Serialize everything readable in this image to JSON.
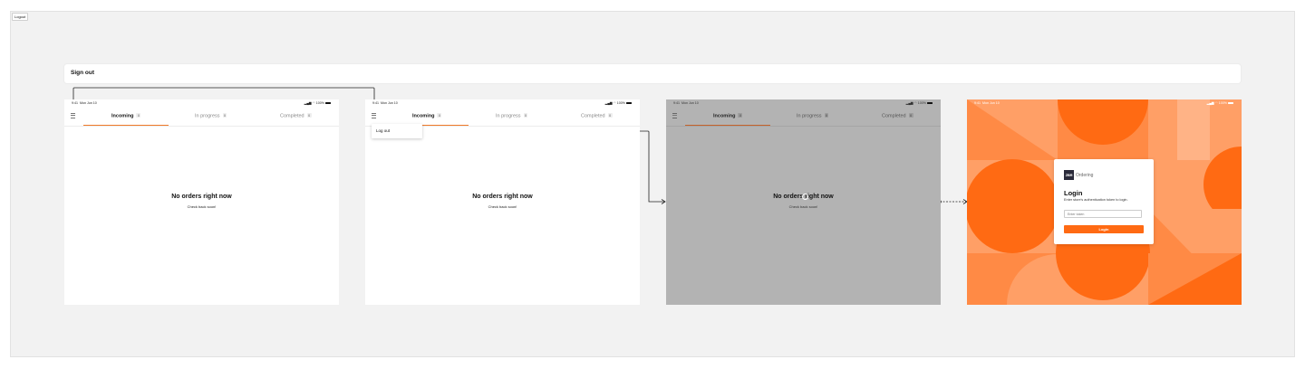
{
  "page": {
    "frame_tag": "Logout",
    "section_title": "Sign out"
  },
  "status": {
    "time": "9:41",
    "date": "Mon Jun 10",
    "battery": "100%"
  },
  "tabs": [
    {
      "label": "Incoming",
      "count": "0"
    },
    {
      "label": "In progress",
      "count": "0"
    },
    {
      "label": "Completed",
      "count": "0"
    }
  ],
  "empty_state": {
    "title": "No orders right now",
    "subtitle": "Check back soon!"
  },
  "menu": {
    "logout_label": "Log out"
  },
  "login": {
    "logo_mark": "ZBR",
    "logo_text": "Ordering",
    "title": "Login",
    "subtitle": "Enter store's authentication token to login.",
    "input_placeholder": "Enter token",
    "button_label": "Login"
  },
  "colors": {
    "accent": "#ff6a13",
    "scrim": "#b3b3b3",
    "canvas": "#f2f2f2"
  }
}
